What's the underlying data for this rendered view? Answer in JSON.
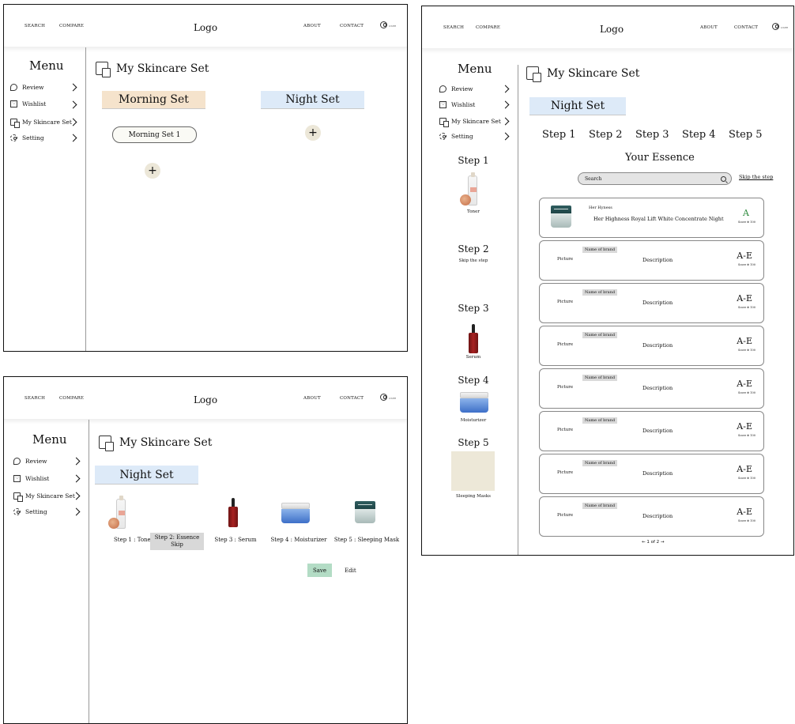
{
  "nav": {
    "search": "SEARCH",
    "compare": "COMPARE",
    "logo": "Logo",
    "about": "ABOUT",
    "contact": "CONTACT",
    "user": "USER"
  },
  "sidebar": {
    "title": "Menu",
    "items": [
      {
        "label": "Review",
        "icon": "chat-icon"
      },
      {
        "label": "Wishlist",
        "icon": "wishlist-icon"
      },
      {
        "label": "My Skincare Set",
        "icon": "skincare-set-icon"
      },
      {
        "label": "Setting",
        "icon": "gear-icon"
      }
    ]
  },
  "page_title": "My Skincare Set",
  "frame_a": {
    "morning": "Morning Set",
    "night": "Night Set",
    "morning_item": "Morning Set 1",
    "plus": "+"
  },
  "frame_b": {
    "night": "Night Set",
    "steps": [
      "Step 1 : Toner",
      "Step 2: Essence",
      "Skip",
      "Step 3 : Serum",
      "Step 4 : Moisturizer",
      "Step 5 : Sleeping Mask"
    ],
    "save": "Save",
    "edit": "Edit"
  },
  "frame_c": {
    "night": "Night Set",
    "tabs": [
      "Step 1",
      "Step 2",
      "Step 3",
      "Step 4",
      "Step 5"
    ],
    "essence_title": "Your Essence",
    "search_placeholder": "Search",
    "skip": "Skip the step",
    "left_steps": [
      {
        "title": "Step 1",
        "sub": "Toner"
      },
      {
        "title": "Step 2",
        "sub": "Skip the step"
      },
      {
        "title": "Step 3",
        "sub": "Serum"
      },
      {
        "title": "Step 4",
        "sub": "Moisturizer"
      },
      {
        "title": "Step 5",
        "sub": "Sleeping Masks"
      }
    ],
    "first_card": {
      "brand": "Her Hyness",
      "name": "Her Highness Royal Lift White Concentrate Night",
      "grade": "A",
      "score": "Score ⊕ 100"
    },
    "placeholder_card": {
      "picture": "Picture",
      "brand": "Name of brand",
      "description": "Description",
      "grade": "A-E",
      "score": "Score ⊕ 100"
    },
    "pager": {
      "prev": "←",
      "current": "1",
      "of": "of",
      "total": "2",
      "next": "→"
    }
  }
}
